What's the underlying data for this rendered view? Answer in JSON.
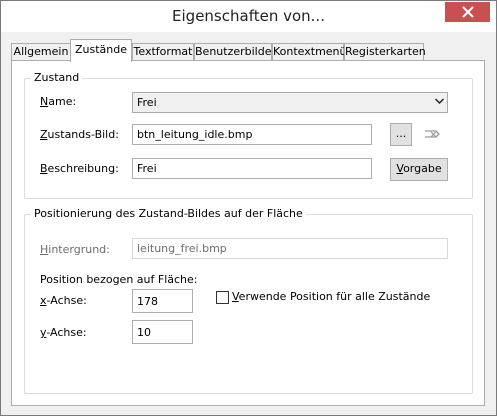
{
  "window": {
    "title": "Eigenschaften von..."
  },
  "tabs": [
    {
      "label": "Allgemein"
    },
    {
      "label": "Zustände"
    },
    {
      "label": "Textformat"
    },
    {
      "label": "Benutzerbilder"
    },
    {
      "label": "Kontextmenü"
    },
    {
      "label": "Registerkarten"
    }
  ],
  "zustand": {
    "group_title": "Zustand",
    "name_label_access": "N",
    "name_label_rest": "ame:",
    "name_value": "Frei",
    "bild_label_access": "Z",
    "bild_label_rest": "ustands-Bild:",
    "bild_value": "btn_leitung_idle.bmp",
    "browse_label": "...",
    "beschreibung_label_access": "B",
    "beschreibung_label_rest": "eschreibung:",
    "beschreibung_value": "Frei",
    "vorgabe_label_access": "V",
    "vorgabe_label_rest": "orgabe"
  },
  "positionierung": {
    "group_title": "Positionierung des Zustand-Bildes auf der Fläche",
    "hintergrund_label_access": "H",
    "hintergrund_label_rest": "intergrund:",
    "hintergrund_value": "leitung_frei.bmp",
    "position_caption": "Position bezogen auf Fläche:",
    "x_label_access": "x",
    "x_label_rest": "-Achse:",
    "x_value": "178",
    "y_label_access": "y",
    "y_label_rest": "-Achse:",
    "y_value": "10",
    "checkbox_label_access": "V",
    "checkbox_label_rest": "erwende Position für alle Zustände",
    "checkbox_checked": false
  },
  "icons": {
    "close": "close-icon",
    "dropdown": "chevron-down-icon",
    "reset": "reset-image-icon"
  },
  "colors": {
    "close_button": "#c75050",
    "panel": "#ffffff",
    "dialog": "#f0f0f0"
  }
}
